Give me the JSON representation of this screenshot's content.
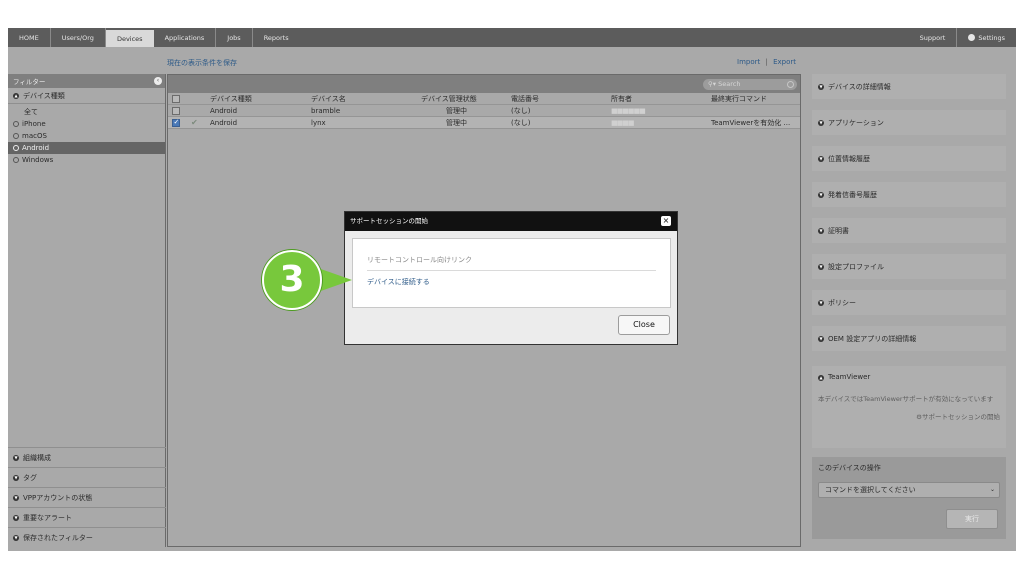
{
  "nav": {
    "left": [
      "HOME",
      "Users/Org",
      "Devices",
      "Applications",
      "Jobs",
      "Reports"
    ],
    "right": [
      "Support",
      "Settings"
    ]
  },
  "toolbar": {
    "save_filter": "現在の表示条件を保存",
    "import": "Import",
    "separator": "|",
    "export": "Export"
  },
  "sidebar": {
    "filter_label": "フィルター",
    "device_type_section": "デバイス種類",
    "device_types": [
      "全て",
      "iPhone",
      "macOS",
      "Android",
      "Windows"
    ],
    "selected_device_type": "Android",
    "bottom_sections": [
      "組織構成",
      "タグ",
      "VPPアカウントの状態",
      "重要なアラート",
      "保存されたフィルター"
    ]
  },
  "search": {
    "placeholder": "Search"
  },
  "table": {
    "columns": [
      "デバイス種類",
      "デバイス名",
      "デバイス管理状態",
      "電話番号",
      "所有者",
      "最終実行コマンド"
    ],
    "rows": [
      {
        "type": "Android",
        "name": "bramble",
        "status": "管理中",
        "phone": "(なし)",
        "owner": "■■■■■■",
        "last_command": ""
      },
      {
        "type": "Android",
        "name": "lynx",
        "status": "管理中",
        "phone": "(なし)",
        "owner": "■■■■",
        "last_command": "TeamViewerを有効化 ..."
      }
    ]
  },
  "right_panel": {
    "cards": [
      "デバイスの詳細情報",
      "アプリケーション",
      "位置情報履歴",
      "発着信番号履歴",
      "証明書",
      "設定プロファイル",
      "ポリシー",
      "OEM 設定アプリの詳細情報"
    ],
    "teamviewer": {
      "title": "TeamViewer",
      "description": "本デバイスではTeamViewerサポートが有効になっています",
      "link": "サポートセッションの開始"
    },
    "operations": {
      "title": "このデバイスの操作",
      "select_placeholder": "コマンドを選択してください",
      "run_label": "実行"
    }
  },
  "modal": {
    "title": "サポートセッションの開始",
    "label": "リモートコントロール向けリンク",
    "link": "デバイスに接続する",
    "close_label": "Close"
  },
  "step_badge": "3"
}
